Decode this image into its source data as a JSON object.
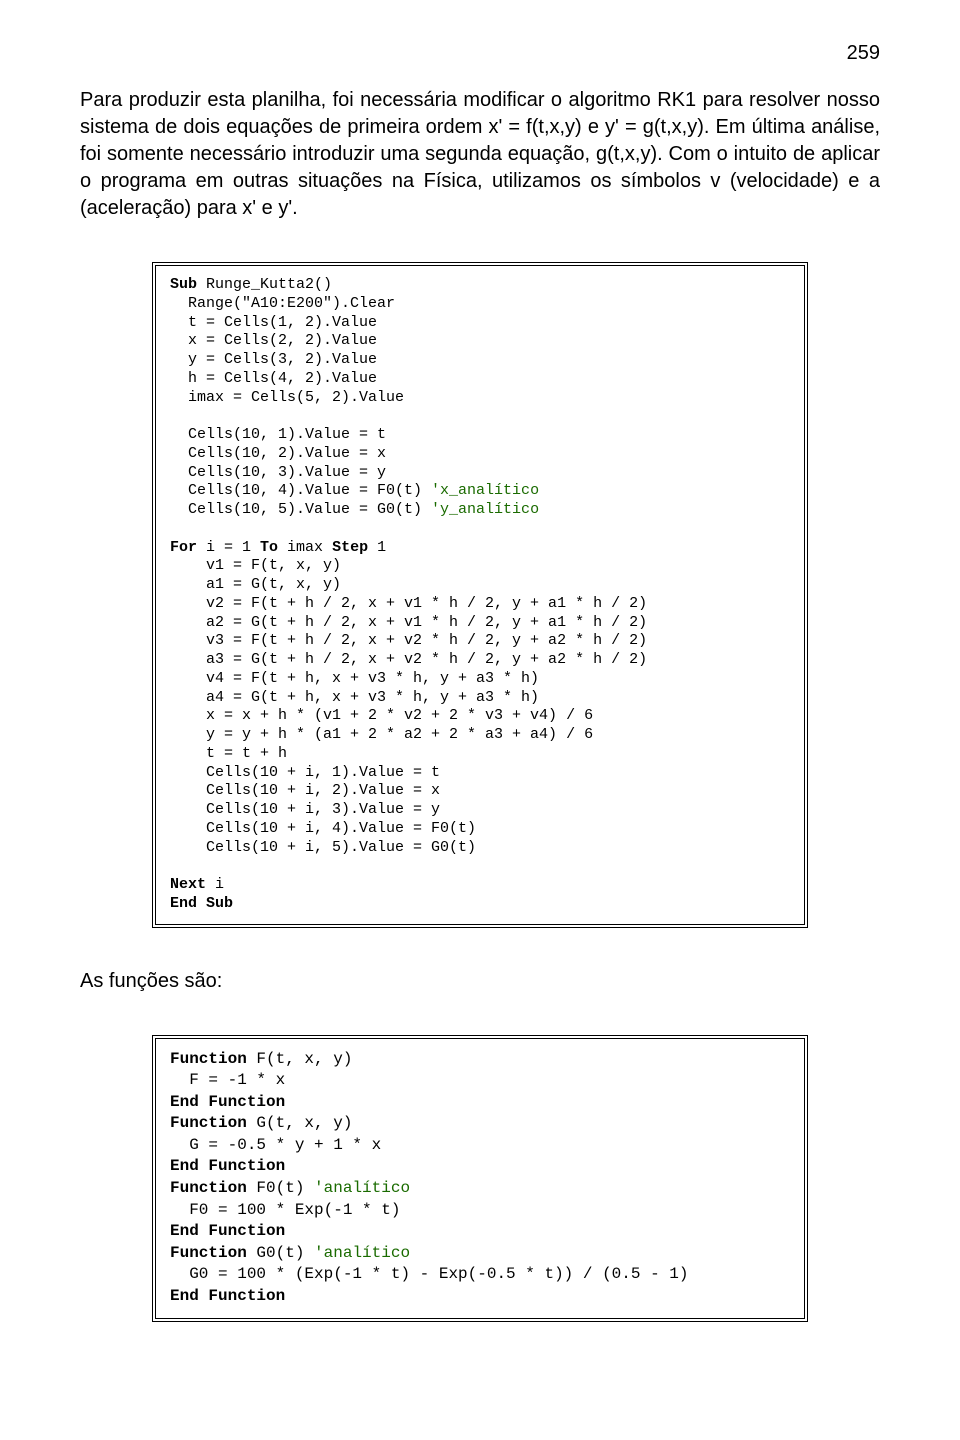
{
  "page_number": "259",
  "paragraph": "Para produzir esta planilha, foi necessária modificar o algoritmo RK1 para resolver nosso sistema de dois equações de primeira ordem x' = f(t,x,y) e y' = g(t,x,y). Em última análise, foi somente necessário introduzir uma segunda equação, g(t,x,y). Com o intuito de aplicar o programa em outras situações na Física, utilizamos os símbolos v (velocidade) e a (aceleração) para x' e y'.",
  "code1": {
    "l1a": "Sub",
    "l1b": " Runge_Kutta2()",
    "l2": "  Range(\"A10:E200\").Clear",
    "l3": "  t = Cells(1, 2).Value",
    "l4": "  x = Cells(2, 2).Value",
    "l5": "  y = Cells(3, 2).Value",
    "l6": "  h = Cells(4, 2).Value",
    "l7": "  imax = Cells(5, 2).Value",
    "l8": "",
    "l9": "  Cells(10, 1).Value = t",
    "l10": "  Cells(10, 2).Value = x",
    "l11": "  Cells(10, 3).Value = y",
    "l12a": "  Cells(10, 4).Value = F0(t) ",
    "l12b": "'x_analítico",
    "l13a": "  Cells(10, 5).Value = G0(t) ",
    "l13b": "'y_analítico",
    "l14": "",
    "l15a": "For",
    "l15b": " i = 1 ",
    "l15c": "To",
    "l15d": " imax ",
    "l15e": "Step",
    "l15f": " 1",
    "l16": "    v1 = F(t, x, y)",
    "l17": "    a1 = G(t, x, y)",
    "l18": "    v2 = F(t + h / 2, x + v1 * h / 2, y + a1 * h / 2)",
    "l19": "    a2 = G(t + h / 2, x + v1 * h / 2, y + a1 * h / 2)",
    "l20": "    v3 = F(t + h / 2, x + v2 * h / 2, y + a2 * h / 2)",
    "l21": "    a3 = G(t + h / 2, x + v2 * h / 2, y + a2 * h / 2)",
    "l22": "    v4 = F(t + h, x + v3 * h, y + a3 * h)",
    "l23": "    a4 = G(t + h, x + v3 * h, y + a3 * h)",
    "l24": "    x = x + h * (v1 + 2 * v2 + 2 * v3 + v4) / 6",
    "l25": "    y = y + h * (a1 + 2 * a2 + 2 * a3 + a4) / 6",
    "l26": "    t = t + h",
    "l27": "    Cells(10 + i, 1).Value = t",
    "l28": "    Cells(10 + i, 2).Value = x",
    "l29": "    Cells(10 + i, 3).Value = y",
    "l30": "    Cells(10 + i, 4).Value = F0(t)",
    "l31": "    Cells(10 + i, 5).Value = G0(t)",
    "l32": "",
    "l33a": "Next",
    "l33b": " i",
    "l34": "End Sub"
  },
  "functions_label": "As funções são:",
  "code2": {
    "l1a": "Function",
    "l1b": " F(t, x, y)",
    "l2": "  F = -1 * x",
    "l3": "End Function",
    "l4a": "Function",
    "l4b": " G(t, x, y)",
    "l5": "  G = -0.5 * y + 1 * x",
    "l6": "End Function",
    "l7a": "Function",
    "l7b": " F0(t) ",
    "l7c": "'analítico",
    "l8": "  F0 = 100 * Exp(-1 * t)",
    "l9": "End Function",
    "l10a": "Function",
    "l10b": " G0(t) ",
    "l10c": "'analítico",
    "l11": "  G0 = 100 * (Exp(-1 * t) - Exp(-0.5 * t)) / (0.5 - 1)",
    "l12": "End Function"
  }
}
